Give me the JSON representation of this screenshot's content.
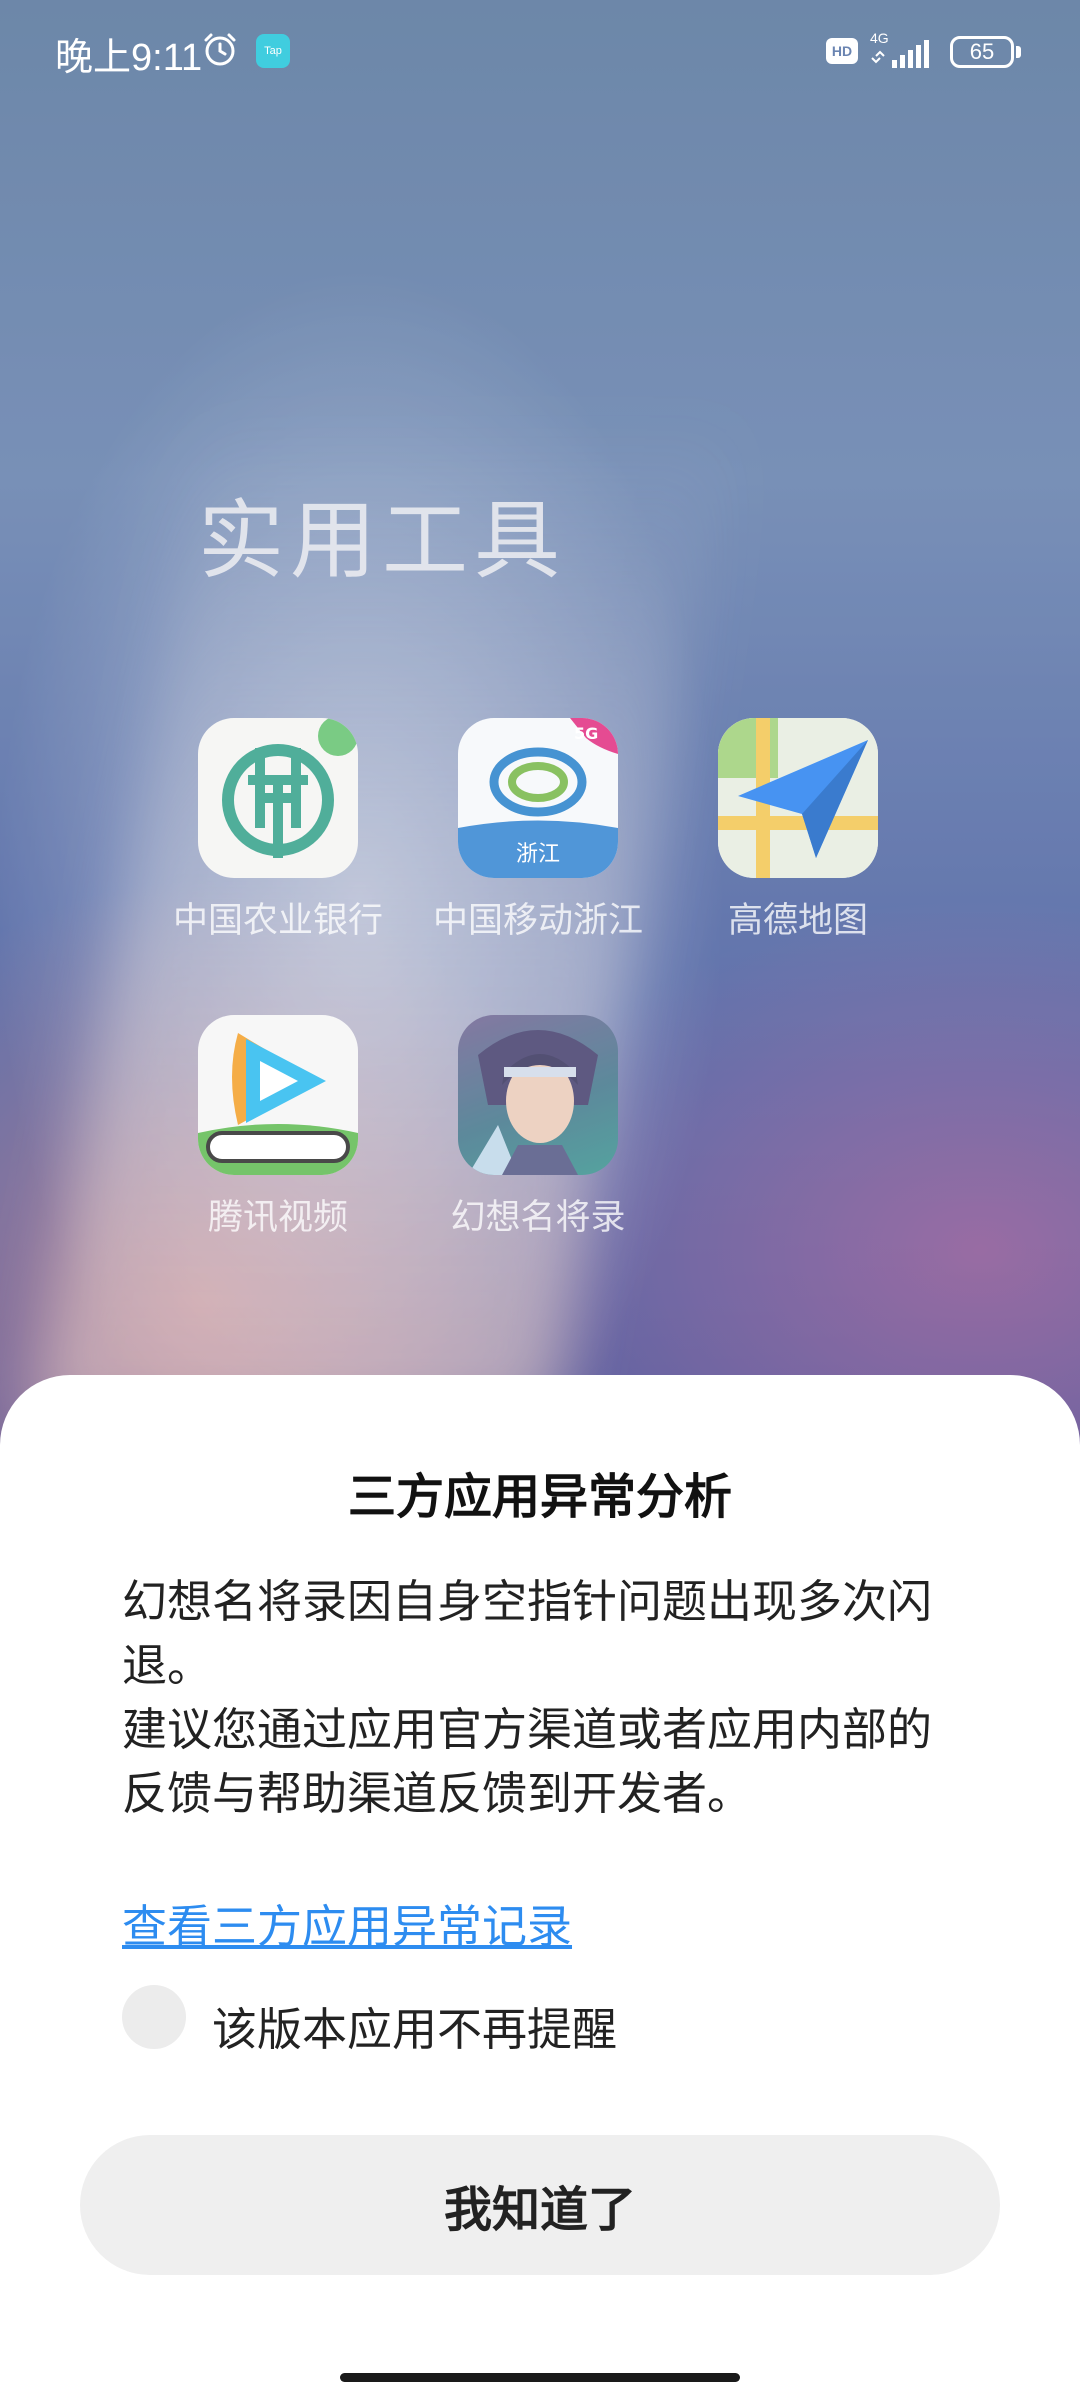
{
  "status_bar": {
    "time": "晚上9:11",
    "alarm_icon": "alarm-clock-icon",
    "tap_badge": "Tap",
    "hd_badge": "HD",
    "network": "4G",
    "battery_level": "65"
  },
  "folder": {
    "title": "实用工具",
    "apps": [
      {
        "label": "中国农业银行",
        "icon": "abc-bank-icon"
      },
      {
        "label": "中国移动浙江",
        "icon": "china-mobile-zhejiang-icon",
        "tile_text": "浙江",
        "badge": "5G"
      },
      {
        "label": "高德地图",
        "icon": "amap-icon"
      },
      {
        "label": "腾讯视频",
        "icon": "tencent-video-icon"
      },
      {
        "label": "幻想名将录",
        "icon": "game-character-icon"
      }
    ]
  },
  "dialog": {
    "title": "三方应用异常分析",
    "message_line1": "幻想名将录因自身空指针问题出现多次闪退。",
    "message_line2": "建议您通过应用官方渠道或者应用内部的反馈与帮助渠道反馈到开发者。",
    "records_link": "查看三方应用异常记录",
    "checkbox_label": "该版本应用不再提醒",
    "checkbox_checked": false,
    "confirm_button": "我知道了"
  },
  "colors": {
    "link": "#2d8cf0",
    "button_bg": "#efefef",
    "sheet_bg": "#ffffff"
  }
}
